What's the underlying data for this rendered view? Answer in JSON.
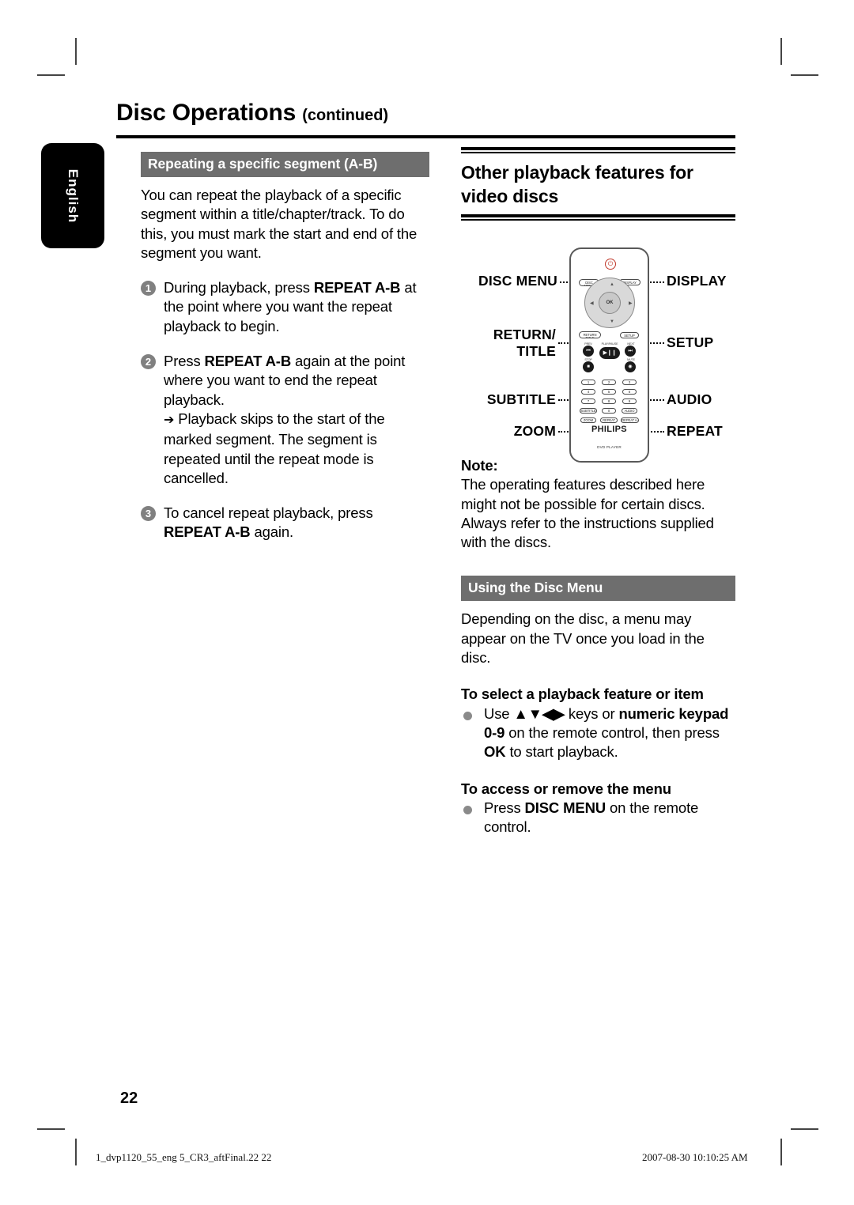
{
  "page": {
    "title_main": "Disc Operations",
    "title_continued": "(continued)",
    "language_tab": "English",
    "page_number": "22"
  },
  "footer": {
    "left": "1_dvp1120_55_eng 5_CR3_aftFinal.22  22",
    "right": "2007-08-30   10:10:25 AM"
  },
  "left_column": {
    "section_bar": "Repeating a specific segment (A-B)",
    "intro": "You can repeat the playback of a specific segment within a title/chapter/track. To do this, you must mark the start and end of the segment you want.",
    "steps": [
      {
        "num": "1",
        "pre": "During playback, press ",
        "key": "REPEAT A-B",
        "post": " at the point where you want the repeat playback to begin."
      },
      {
        "num": "2",
        "pre": "Press ",
        "key": "REPEAT A-B",
        "post": " again at the point where you want to end the repeat playback.",
        "arrow_glyph": "➔",
        "arrow_text": "Playback skips to the start of the marked segment. The segment is repeated until the repeat mode is cancelled."
      },
      {
        "num": "3",
        "pre": "To cancel repeat playback, press ",
        "key": "REPEAT A-B",
        "post": " again."
      }
    ]
  },
  "right_column": {
    "heading": "Other playback features for video discs",
    "note_label": "Note:",
    "note_text": "The operating features described here might not be possible for certain discs. Always refer to the instructions supplied with the discs.",
    "disc_menu_bar": "Using the Disc Menu",
    "disc_menu_intro": "Depending on the disc, a menu may appear on the TV once you load in the disc.",
    "select_head": "To select a playback feature or item",
    "select_pre": "Use ",
    "select_arrows": "▲▼◀▶",
    "select_mid": " keys or ",
    "select_keypad": "numeric keypad",
    "select_range": "0-9",
    "select_post": " on the remote control, then press ",
    "select_ok": "OK",
    "select_tail": " to start playback.",
    "access_head": "To access or remove the menu",
    "access_pre": "Press ",
    "access_key": "DISC MENU",
    "access_post": " on the remote control."
  },
  "remote": {
    "labels": {
      "disc_menu": "DISC MENU",
      "display": "DISPLAY",
      "return_title_line1": "RETURN/",
      "return_title_line2": "TITLE",
      "setup": "SETUP",
      "subtitle": "SUBTITLE",
      "audio": "AUDIO",
      "zoom": "ZOOM",
      "repeat": "REPEAT"
    },
    "brand": "PHILIPS",
    "sub_brand": "DVD PLAYER",
    "keys": {
      "power": "⏻",
      "disc_menu_cap1": "DISC",
      "disc_menu_cap2": "MENU",
      "display": "DISPLAY",
      "ok": "OK",
      "up": "▲",
      "down": "▼",
      "left": "◀",
      "right": "▶",
      "return_cap1": "RETURN",
      "return_cap2": "TITLE",
      "setup": "SETUP",
      "prev_cap": "PREV",
      "prev": "⏮",
      "playpause_cap": "PLAY/PAUSE",
      "playpause": "▶❙❙",
      "next_cap": "NEXT",
      "next": "⏭",
      "stop_cap": "STOP",
      "stop": "■",
      "mute_cap": "MUTE",
      "mute": "◉",
      "num1": "1",
      "num2": "2",
      "num3": "3",
      "num4": "4",
      "num5": "5",
      "num6": "6",
      "num7": "7",
      "num8": "8",
      "num9": "9",
      "num0": "0",
      "subtitle": "SUBTITLE",
      "audio": "AUDIO",
      "zoom": "ZOOM",
      "repeat": "REPEAT",
      "repeat_ab": "REPEAT A-B"
    }
  }
}
